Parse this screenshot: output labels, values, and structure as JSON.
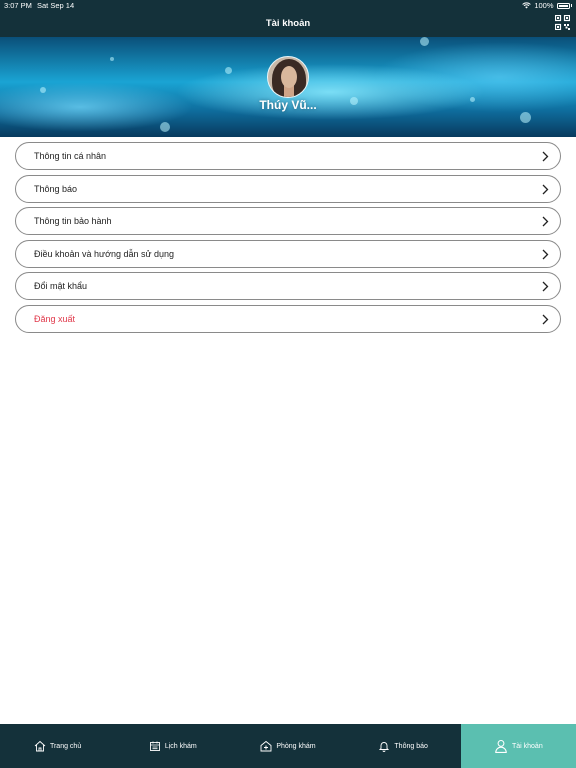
{
  "status_bar": {
    "time": "3:07 PM",
    "date": "Sat Sep 14",
    "battery": "100%"
  },
  "header": {
    "title": "Tài khoản",
    "qr_icon": "qr-code-icon"
  },
  "profile": {
    "name": "Thúy Vũ..."
  },
  "menu": {
    "items": [
      {
        "label": "Thông tin cá nhân"
      },
      {
        "label": "Thông báo"
      },
      {
        "label": "Thông tin bảo hành"
      },
      {
        "label": "Điều khoản và hướng dẫn sử dụng"
      },
      {
        "label": "Đổi mật khẩu"
      },
      {
        "label": "Đăng xuất"
      }
    ]
  },
  "tabbar": {
    "tabs": [
      {
        "label": "Trang chủ",
        "icon": "home-icon"
      },
      {
        "label": "Lịch khám",
        "icon": "calendar-icon"
      },
      {
        "label": "Phòng khám",
        "icon": "clinic-icon"
      },
      {
        "label": "Thông báo",
        "icon": "bell-icon"
      },
      {
        "label": "Tài khoản",
        "icon": "user-icon",
        "active": true
      }
    ]
  },
  "colors": {
    "header_bg": "#14313a",
    "active_tab": "#5bbfb0",
    "logout_text": "#e0384a"
  }
}
